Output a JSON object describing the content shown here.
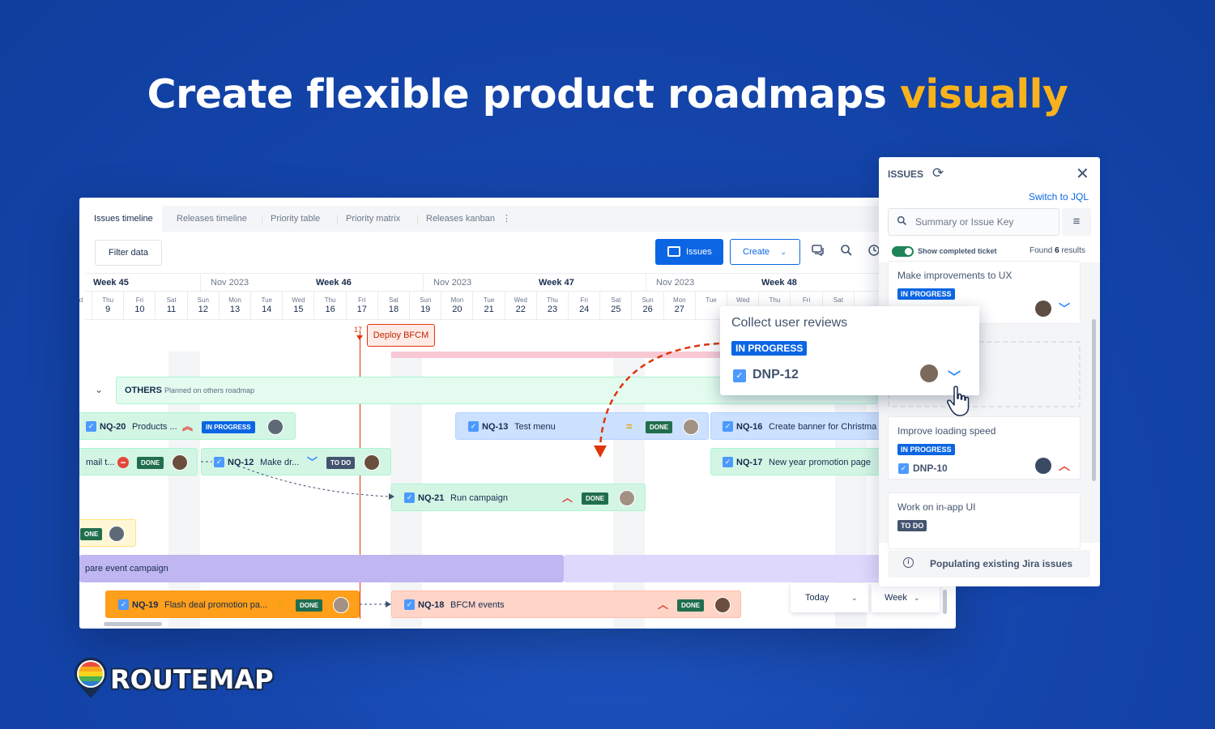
{
  "headline": {
    "main": "Create flexible product roadmaps ",
    "accent": "visually"
  },
  "tabs": [
    "Issues timeline",
    "Releases timeline",
    "Priority table",
    "Priority matrix",
    "Releases kanban"
  ],
  "tab_more": "⋮",
  "toolbar": {
    "filter": "Filter data",
    "issues": "Issues",
    "create": "Create",
    "create_chev": "⌄"
  },
  "timeline": {
    "weeks": [
      {
        "label": "Week 45"
      },
      {
        "month": "Nov 2023",
        "label": "Week 46"
      },
      {
        "month": "Nov 2023",
        "label": "Week 47"
      },
      {
        "month": "Nov 2023",
        "label": "Week 48"
      }
    ],
    "days": [
      {
        "n": "Wed",
        "d": "8"
      },
      {
        "n": "Thu",
        "d": "9"
      },
      {
        "n": "Fri",
        "d": "10"
      },
      {
        "n": "Sat",
        "d": "11"
      },
      {
        "n": "Sun",
        "d": "12"
      },
      {
        "n": "Mon",
        "d": "13"
      },
      {
        "n": "Tue",
        "d": "14"
      },
      {
        "n": "Wed",
        "d": "15"
      },
      {
        "n": "Thu",
        "d": "16"
      },
      {
        "n": "Fri",
        "d": "17"
      },
      {
        "n": "Sat",
        "d": "18"
      },
      {
        "n": "Sun",
        "d": "19"
      },
      {
        "n": "Mon",
        "d": "20"
      },
      {
        "n": "Tue",
        "d": "21"
      },
      {
        "n": "Wed",
        "d": "22"
      },
      {
        "n": "Thu",
        "d": "23"
      },
      {
        "n": "Fri",
        "d": "24"
      },
      {
        "n": "Sat",
        "d": "25"
      },
      {
        "n": "Sun",
        "d": "26"
      },
      {
        "n": "Mon",
        "d": "27"
      },
      {
        "n": "Tue",
        "d": ""
      },
      {
        "n": "Wed",
        "d": ""
      },
      {
        "n": "Thu",
        "d": ""
      },
      {
        "n": "Fri",
        "d": ""
      },
      {
        "n": "Sat",
        "d": ""
      }
    ],
    "today_num": "17",
    "deploy": "Deploy BFCM",
    "group": {
      "title": "OTHERS",
      "sub": "Planned on others roadmap"
    },
    "bars": {
      "nq20": {
        "key": "NQ-20",
        "summary": "Products ...",
        "status": "IN PROGRESS"
      },
      "nq13": {
        "key": "NQ-13",
        "summary": "Test menu",
        "status": "DONE"
      },
      "nq16": {
        "key": "NQ-16",
        "summary": "Create banner for Christma"
      },
      "mail": {
        "summary": "mail t...",
        "status": "DONE"
      },
      "nq12": {
        "key": "NQ-12",
        "summary": "Make dr...",
        "status": "TO DO"
      },
      "nq17": {
        "key": "NQ-17",
        "summary": "New year promotion page"
      },
      "nq21": {
        "key": "NQ-21",
        "summary": "Run campaign",
        "status": "DONE"
      },
      "one": {
        "status": "ONE"
      },
      "event": {
        "summary": "pare event campaign"
      },
      "nq19": {
        "key": "NQ-19",
        "summary": "Flash deal promotion pa...",
        "status": "DONE"
      },
      "nq18": {
        "key": "NQ-18",
        "summary": "BFCM events",
        "status": "DONE"
      }
    },
    "controls": {
      "today": "Today",
      "week": "Week",
      "chev": "⌄"
    }
  },
  "drag_card": {
    "title": "Collect user reviews",
    "status": "IN PROGRESS",
    "key": "DNP-12"
  },
  "panel": {
    "title": "ISSUES",
    "switch": "Switch to JQL",
    "search_placeholder": "Summary or Issue Key",
    "toggle_label": "Show completed ticket",
    "found_pre": "Found ",
    "found_count": "6",
    "found_post": " results",
    "cards": [
      {
        "title": "Make improvements to UX",
        "status": "IN PROGRESS"
      },
      {
        "title": "Improve loading speed",
        "status": "IN PROGRESS",
        "key": "DNP-10"
      },
      {
        "title": "Work on in-app UI",
        "status": "TO DO"
      }
    ],
    "footer": "Populating existing Jira issues"
  },
  "logo": {
    "text": "ROUTEMAP"
  },
  "colors": {
    "accent": "#f7b21c",
    "background": "#1546ad",
    "primary": "#0c66e4",
    "done": "#216e4e"
  }
}
